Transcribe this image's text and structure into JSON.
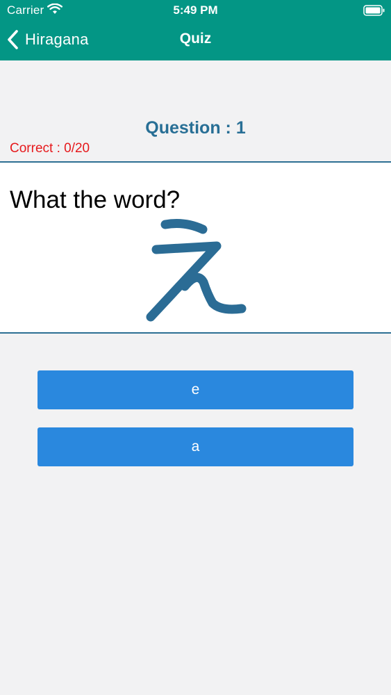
{
  "status_bar": {
    "carrier": "Carrier",
    "time": "5:49 PM"
  },
  "nav": {
    "back_label": "Hiragana",
    "title": "Quiz"
  },
  "quiz": {
    "question_label": "Question : 1",
    "correct_label": "Correct : 0/20",
    "prompt": "What the word?",
    "character": "え",
    "answers": [
      "e",
      "a"
    ]
  },
  "colors": {
    "header": "#039685",
    "question_text": "#286f95",
    "correct_text": "#e6191c",
    "answer_button": "#2a88de",
    "divider": "#2d6f93",
    "background": "#f2f2f3"
  }
}
